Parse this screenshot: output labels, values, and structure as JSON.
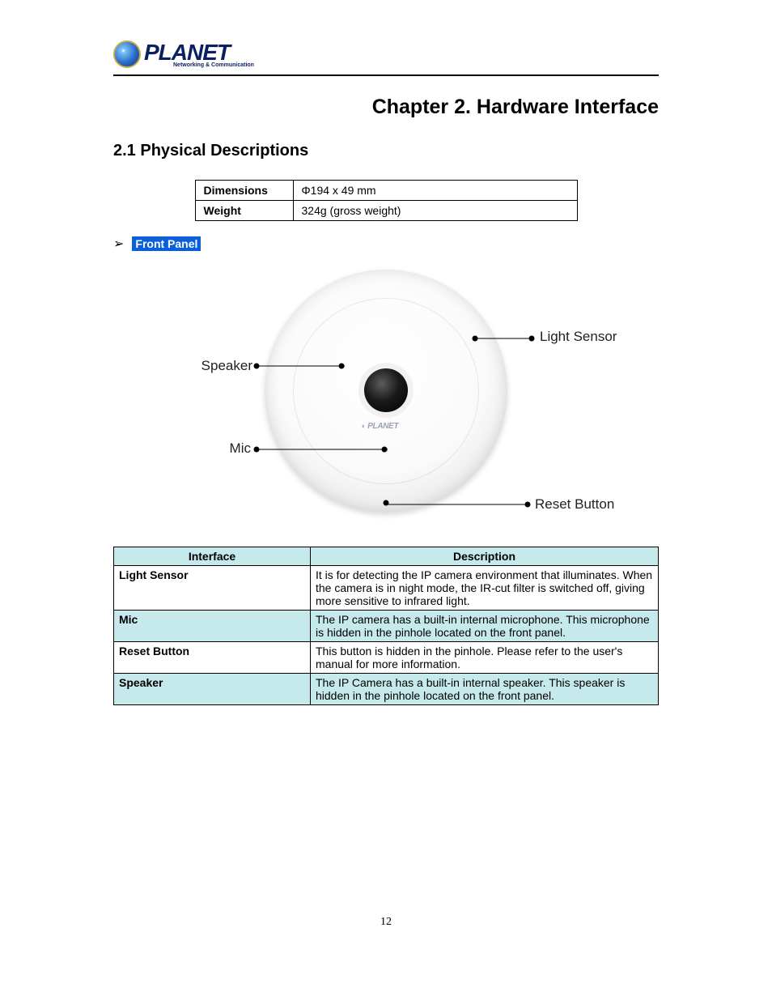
{
  "logo": {
    "name": "PLANET",
    "sub": "Networking & Communication"
  },
  "chapter_title": "Chapter 2.    Hardware Interface",
  "section_title": "2.1 Physical Descriptions",
  "spec": {
    "rows": [
      {
        "label": "Dimensions",
        "value": "Φ194 x 49 mm"
      },
      {
        "label": "Weight",
        "value": "324g (gross weight)"
      }
    ]
  },
  "front_panel_label": "Front Panel",
  "callouts": {
    "light": "Light Sensor",
    "speaker": "Speaker",
    "mic": "Mic",
    "reset": "Reset Button"
  },
  "device_logo": "PLANET",
  "desc_table": {
    "headers": [
      "Interface",
      "Description"
    ],
    "rows": [
      {
        "iface": "Light Sensor",
        "desc": "It is for detecting the IP camera environment that illuminates. When the camera is in night mode, the IR-cut filter is switched off, giving more sensitive to infrared light."
      },
      {
        "iface": "Mic",
        "desc": "The IP camera has a built-in internal microphone. This microphone is hidden in the pinhole located on the front panel."
      },
      {
        "iface": "Reset Button",
        "desc": "This button is hidden in the pinhole. Please refer to the user's manual for more information."
      },
      {
        "iface": "Speaker",
        "desc": "The IP Camera has a built-in internal speaker. This speaker is hidden in the pinhole located on the front panel."
      }
    ]
  },
  "page_number": "12"
}
